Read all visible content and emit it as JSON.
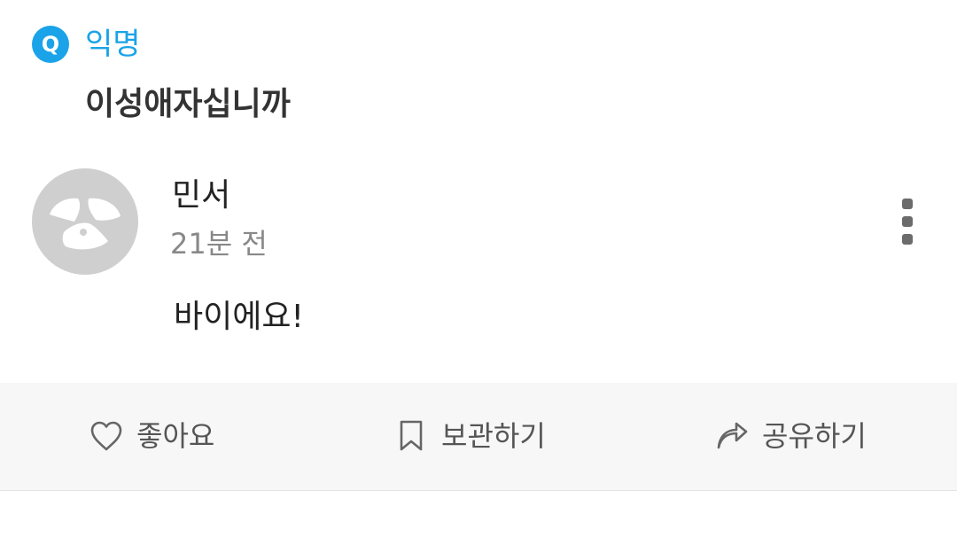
{
  "question": {
    "badge": "Q",
    "category": "익명",
    "title": "이성애자십니까"
  },
  "answer": {
    "author": "민서",
    "time": "21분 전",
    "body": "바이에요!"
  },
  "actions": {
    "like_label": "좋아요",
    "save_label": "보관하기",
    "share_label": "공유하기"
  },
  "colors": {
    "accent": "#1aa3e8",
    "avatar_bg": "#cfcfcf",
    "action_bar_bg": "#f7f7f7"
  },
  "icons": {
    "badge": "q-badge",
    "avatar": "default-avatar-icon",
    "more": "more-vertical-icon",
    "like": "heart-icon",
    "save": "bookmark-icon",
    "share": "share-arrow-icon"
  }
}
